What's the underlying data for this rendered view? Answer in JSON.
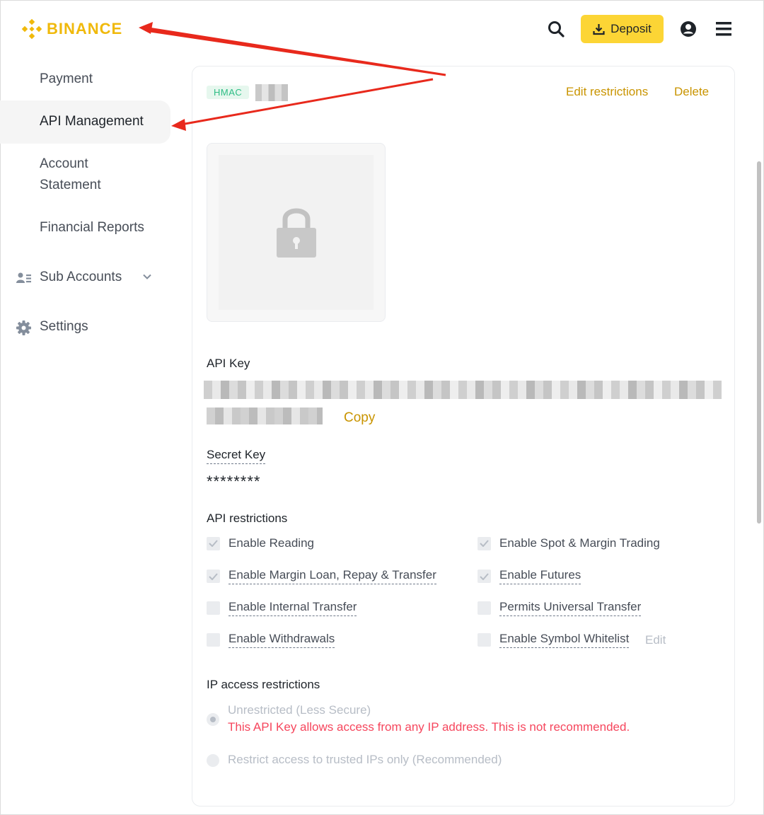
{
  "brand": {
    "name": "BINANCE",
    "color": "#F0B90B"
  },
  "header": {
    "search_icon": "search-icon",
    "deposit_label": "Deposit",
    "profile_icon": "user-circle-icon",
    "menu_icon": "hamburger-menu-icon"
  },
  "sidebar": {
    "items": [
      {
        "label": "Payment"
      },
      {
        "label": "API Management",
        "active": true
      },
      {
        "label": "Account"
      },
      {
        "label": "Statement"
      },
      {
        "label": "Financial Reports"
      },
      {
        "label": "Sub Accounts",
        "icon": "users-icon"
      },
      {
        "label": "Settings",
        "icon": "gear-icon"
      }
    ]
  },
  "api_card": {
    "badge": "HMAC",
    "edit_restrictions": "Edit restrictions",
    "delete": "Delete",
    "api_key_label": "API Key",
    "copy": "Copy",
    "secret_key_label": "Secret Key",
    "secret_key_value": "********",
    "api_restrictions_label": "API restrictions",
    "restrictions": [
      {
        "label": "Enable Reading",
        "checked": true
      },
      {
        "label": "Enable Spot & Margin Trading",
        "checked": true
      },
      {
        "label": "Enable Margin Loan, Repay & Transfer",
        "checked": true
      },
      {
        "label": "Enable Futures",
        "checked": true
      },
      {
        "label": "Enable Internal Transfer",
        "checked": false
      },
      {
        "label": "Permits Universal Transfer",
        "checked": false
      },
      {
        "label": "Enable Withdrawals",
        "checked": false
      },
      {
        "label": "Enable Symbol Whitelist",
        "checked": false
      }
    ],
    "whitelist_edit": "Edit",
    "ip_label": "IP access restrictions",
    "ip_unrestricted": "Unrestricted (Less Secure)",
    "ip_warning": "This API Key allows access from any IP address. This is not recommended.",
    "ip_restricted": "Restrict access to trusted IPs only (Recommended)"
  },
  "colors": {
    "accent": "#FCD535",
    "link": "#C99400",
    "warning": "#F6465D",
    "success": "#2EBD85",
    "annotation": "#E8291C"
  }
}
